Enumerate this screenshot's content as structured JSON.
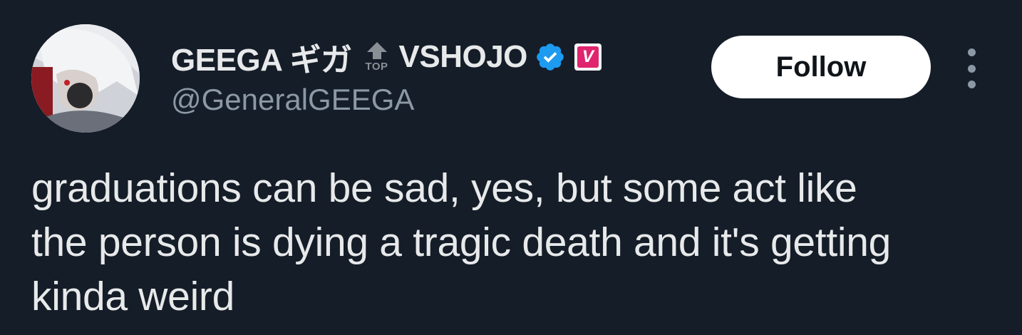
{
  "author": {
    "display_name": "GEEGA ギガ",
    "top_label": "TOP",
    "org_name": "VSHOJO",
    "org_badge_letter": "V",
    "handle": "@GeneralGEEGA",
    "verified_icon": "verified-badge-icon",
    "verified_color": "#1d9bf0",
    "org_badge_color": "#e0246e"
  },
  "actions": {
    "follow_label": "Follow",
    "more_icon": "more-vertical-icon"
  },
  "tweet": {
    "text": "graduations can be sad, yes, but some act like\nthe person is dying a tragic death and it's getting\nkinda weird"
  },
  "colors": {
    "background": "#151d28",
    "text": "#e7e9ea",
    "muted": "#8b98a5"
  }
}
